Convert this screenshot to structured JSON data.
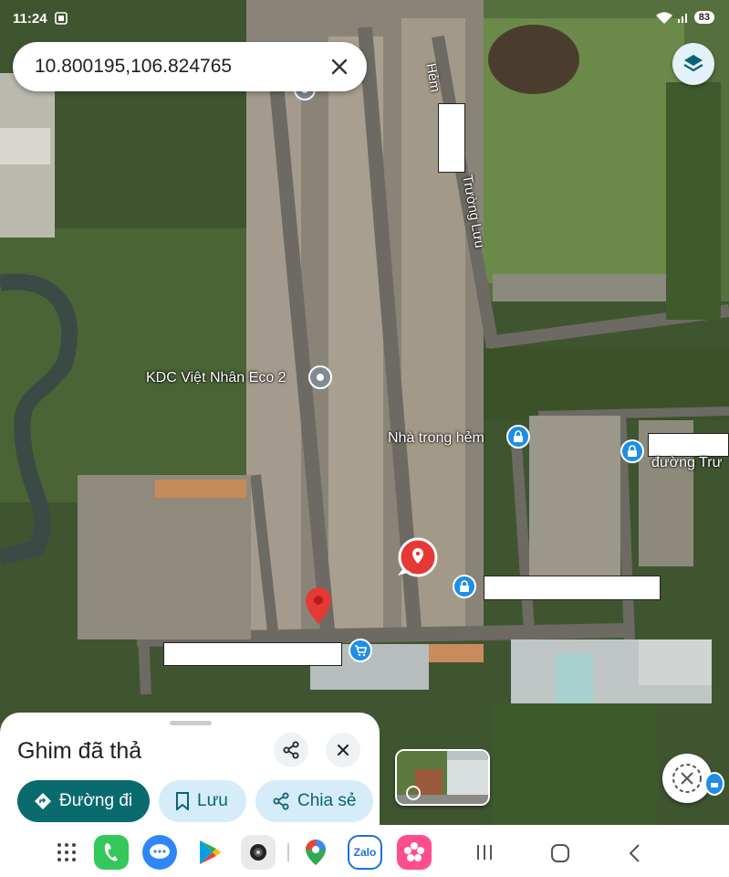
{
  "status_bar": {
    "time": "11:24",
    "battery": "83"
  },
  "search": {
    "query": "10.800195,106.824765"
  },
  "map": {
    "labels": {
      "street_hem": "Hẻm",
      "street_truong_luu": "Trường Lưu",
      "kdc": "KDC Việt Nhân Eco 2",
      "nha_trong_hem": "Nhà trong hẻm",
      "duong_tru": "đường Trư"
    }
  },
  "sheet": {
    "title": "Ghim đã thả",
    "directions_label": "Đường đi",
    "save_label": "Lưu",
    "share_label": "Chia sẻ"
  },
  "dock": {
    "zalo_label": "Zalo"
  },
  "colors": {
    "accent_teal": "#0a6b6f",
    "chip_light": "#d6ecf8",
    "pin_red": "#e53935",
    "poi_blue": "#1f8ee6"
  }
}
